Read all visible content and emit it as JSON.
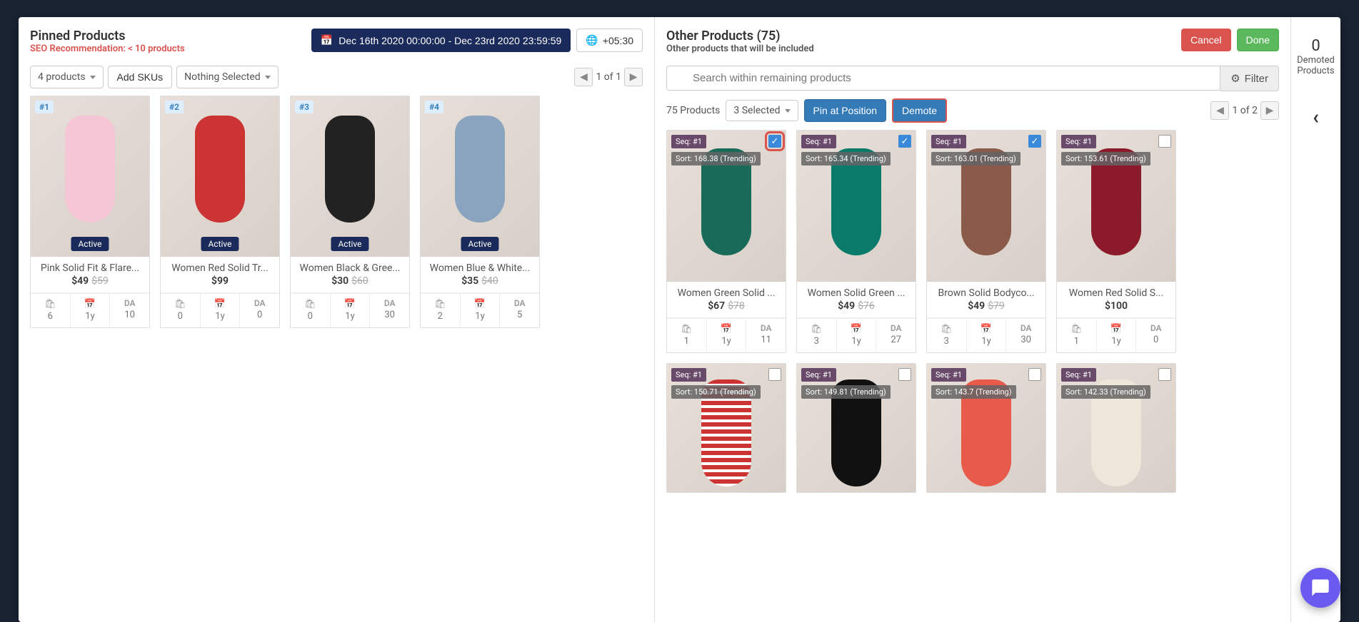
{
  "left": {
    "title": "Pinned Products",
    "seo": "SEO Recommendation: < 10 products",
    "date_range": "Dec 16th 2020 00:00:00 - Dec 23rd 2020 23:59:59",
    "tz": "+05:30",
    "count_dd": "4 products",
    "add_skus": "Add SKUs",
    "nothing_sel": "Nothing Selected",
    "pager": "1 of 1",
    "products": [
      {
        "pos": "#1",
        "title": "Pink Solid Fit & Flare...",
        "price": "$49",
        "old": "$59",
        "status": "Active",
        "s1": "6",
        "s2": "1y",
        "s3": "10",
        "color": "pink"
      },
      {
        "pos": "#2",
        "title": "Women Red Solid Tr...",
        "price": "$99",
        "old": "",
        "status": "Active",
        "s1": "0",
        "s2": "1y",
        "s3": "0",
        "color": "red"
      },
      {
        "pos": "#3",
        "title": "Women Black & Gree...",
        "price": "$30",
        "old": "$60",
        "status": "Active",
        "s1": "0",
        "s2": "1y",
        "s3": "30",
        "color": "black"
      },
      {
        "pos": "#4",
        "title": "Women Blue & White...",
        "price": "$35",
        "old": "$40",
        "status": "Active",
        "s1": "2",
        "s2": "1y",
        "s3": "5",
        "color": "blue"
      }
    ]
  },
  "right": {
    "title": "Other Products (75)",
    "subtitle": "Other products that will be included",
    "cancel": "Cancel",
    "done": "Done",
    "search_ph": "Search within remaining products",
    "filter": "Filter",
    "count_label": "75 Products",
    "selected_dd": "3 Selected",
    "pin_btn": "Pin at Position",
    "demote_btn": "Demote",
    "pager": "1 of 2",
    "products": [
      {
        "seq": "Seq: #1",
        "sort": "Sort: 168.38 (Trending)",
        "title": "Women Green Solid ...",
        "price": "$67",
        "old": "$78",
        "s1": "1",
        "s2": "1y",
        "s3": "11",
        "chk": true,
        "hl": true,
        "color": "green"
      },
      {
        "seq": "Seq: #1",
        "sort": "Sort: 165.34 (Trending)",
        "title": "Women Solid Green ...",
        "price": "$49",
        "old": "$76",
        "s1": "3",
        "s2": "1y",
        "s3": "27",
        "chk": true,
        "color": "teal"
      },
      {
        "seq": "Seq: #1",
        "sort": "Sort: 163.01 (Trending)",
        "title": "Brown Solid Bodyco...",
        "price": "$49",
        "old": "$79",
        "s1": "3",
        "s2": "1y",
        "s3": "30",
        "chk": true,
        "color": "brown"
      },
      {
        "seq": "Seq: #1",
        "sort": "Sort: 153.61 (Trending)",
        "title": "Women Red Solid S...",
        "price": "$100",
        "old": "",
        "s1": "1",
        "s2": "1y",
        "s3": "0",
        "chk": false,
        "color": "darkred"
      },
      {
        "seq": "Seq: #1",
        "sort": "Sort: 150.71 (Trending)",
        "title": "",
        "price": "",
        "old": "",
        "chk": false,
        "color": "stripe",
        "partial": true
      },
      {
        "seq": "Seq: #1",
        "sort": "Sort: 149.81 (Trending)",
        "title": "",
        "price": "",
        "old": "",
        "chk": false,
        "color": "dblack",
        "partial": true
      },
      {
        "seq": "Seq: #1",
        "sort": "Sort: 143.7 (Trending)",
        "title": "",
        "price": "",
        "old": "",
        "chk": false,
        "color": "coral",
        "partial": true
      },
      {
        "seq": "Seq: #1",
        "sort": "Sort: 142.33 (Trending)",
        "title": "",
        "price": "",
        "old": "",
        "chk": false,
        "color": "cream",
        "partial": true
      }
    ]
  },
  "demoted": {
    "count": "0",
    "l1": "Demoted",
    "l2": "Products"
  },
  "stat_label": "DA"
}
